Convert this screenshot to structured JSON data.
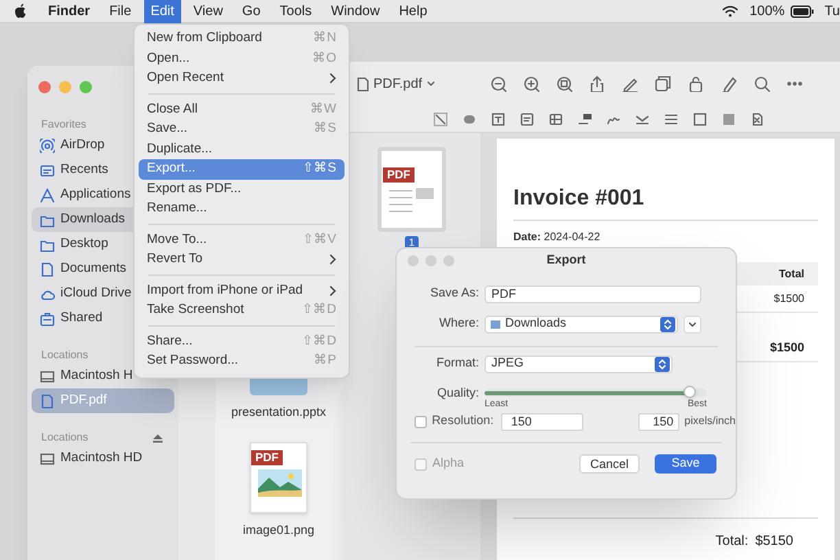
{
  "menu_bar": {
    "items": [
      {
        "label": "Finder",
        "selected": false,
        "bold": true
      },
      {
        "label": "File",
        "selected": false,
        "bold": false
      },
      {
        "label": "Edit",
        "selected": true,
        "bold": false
      },
      {
        "label": "View",
        "selected": false,
        "bold": false
      },
      {
        "label": "Go",
        "selected": false,
        "bold": false
      },
      {
        "label": "Tools",
        "selected": false,
        "bold": false
      },
      {
        "label": "Window",
        "selected": false,
        "bold": false
      },
      {
        "label": "Help",
        "selected": false,
        "bold": false
      }
    ],
    "battery_percent": "100%",
    "clock": "Tu"
  },
  "edit_menu": {
    "groups": [
      [
        {
          "label": "New from Clipboard",
          "shortcut": "⌘N",
          "submenu": false,
          "selected": false
        },
        {
          "label": "Open...",
          "shortcut": "⌘O",
          "submenu": false,
          "selected": false
        },
        {
          "label": "Open Recent",
          "submenu": true,
          "selected": false
        }
      ],
      [
        {
          "label": "Close All",
          "shortcut": "⌘W",
          "submenu": false,
          "selected": false
        },
        {
          "label": "Save...",
          "shortcut": "⌘S",
          "submenu": false,
          "selected": false
        },
        {
          "label": "Duplicate...",
          "submenu": false,
          "selected": false
        },
        {
          "label": "Export...",
          "shortcut": "⇧⌘S",
          "submenu": false,
          "selected": true
        },
        {
          "label": "Export as PDF...",
          "submenu": false,
          "selected": false
        },
        {
          "label": "Rename...",
          "submenu": false,
          "selected": false
        }
      ],
      [
        {
          "label": "Move To...",
          "shortcut": "⇧⌘V",
          "submenu": false,
          "selected": false
        },
        {
          "label": "Revert To",
          "submenu": true,
          "selected": false
        }
      ],
      [
        {
          "label": "Import from iPhone or iPad",
          "submenu": true,
          "selected": false
        },
        {
          "label": "Take Screenshot",
          "shortcut": "⇧⌘D",
          "submenu": false,
          "selected": false
        }
      ],
      [
        {
          "label": "Share...",
          "shortcut": "⇧⌘D",
          "submenu": false,
          "selected": false
        },
        {
          "label": "Set Password...",
          "shortcut": "⌘P",
          "submenu": false,
          "selected": false
        }
      ]
    ]
  },
  "finder": {
    "sidebar": [
      {
        "heading": "Favorites",
        "eject": false,
        "items": [
          {
            "label": "AirDrop",
            "kind": "airdrop",
            "selected": false
          },
          {
            "label": "Recents",
            "kind": "recents",
            "selected": false
          },
          {
            "label": "Applications",
            "kind": "applications",
            "selected": false
          },
          {
            "label": "Downloads",
            "kind": "folder",
            "selected": true
          },
          {
            "label": "Desktop",
            "kind": "folder",
            "selected": false
          },
          {
            "label": "Documents",
            "kind": "document",
            "selected": false
          },
          {
            "label": "iCloud Drive",
            "kind": "cloud",
            "selected": false
          },
          {
            "label": "Shared",
            "kind": "shared",
            "selected": false
          }
        ]
      },
      {
        "heading": "Locations",
        "eject": false,
        "items": [
          {
            "label": "Macintosh H",
            "kind": "disk",
            "selected": false
          },
          {
            "label": "PDF.pdf",
            "kind": "document",
            "selected": true
          }
        ]
      },
      {
        "heading": "Locations",
        "eject": true,
        "items": [
          {
            "label": "Macintosh HD",
            "kind": "disk",
            "selected": false
          }
        ]
      }
    ],
    "files": [
      {
        "name": "presentation.pptx",
        "kind": "folder"
      },
      {
        "name": "image01.png",
        "kind": "pdf-image",
        "badge": "PDF"
      }
    ]
  },
  "preview": {
    "title": "PDF.pdf",
    "thumbnail": {
      "badge": "PDF",
      "page": "1"
    },
    "document": {
      "heading": "Invoice #001",
      "date": "**Date:** 2024-04-22",
      "column": "Total",
      "rows": [
        "$1500",
        "$1500"
      ],
      "total_label": "Total:",
      "total": "$5150"
    }
  },
  "export_dialog": {
    "title": "Export",
    "save_as_label": "Save As:",
    "save_as": "PDF",
    "where_label": "Where:",
    "where": "Downloads",
    "format_label": "Format:",
    "format": "JPEG",
    "quality_label": "Quality:",
    "level": 0.92,
    "least": "Least",
    "best": "Best",
    "resolution_label": "Resolution:",
    "resolution_checked": false,
    "resolution": "150",
    "resolution_2": "150",
    "resolution_unit": "pixels/inch",
    "alpha_label": "Alpha",
    "alpha_checked": false,
    "cancel": "Cancel",
    "save": "Save"
  }
}
